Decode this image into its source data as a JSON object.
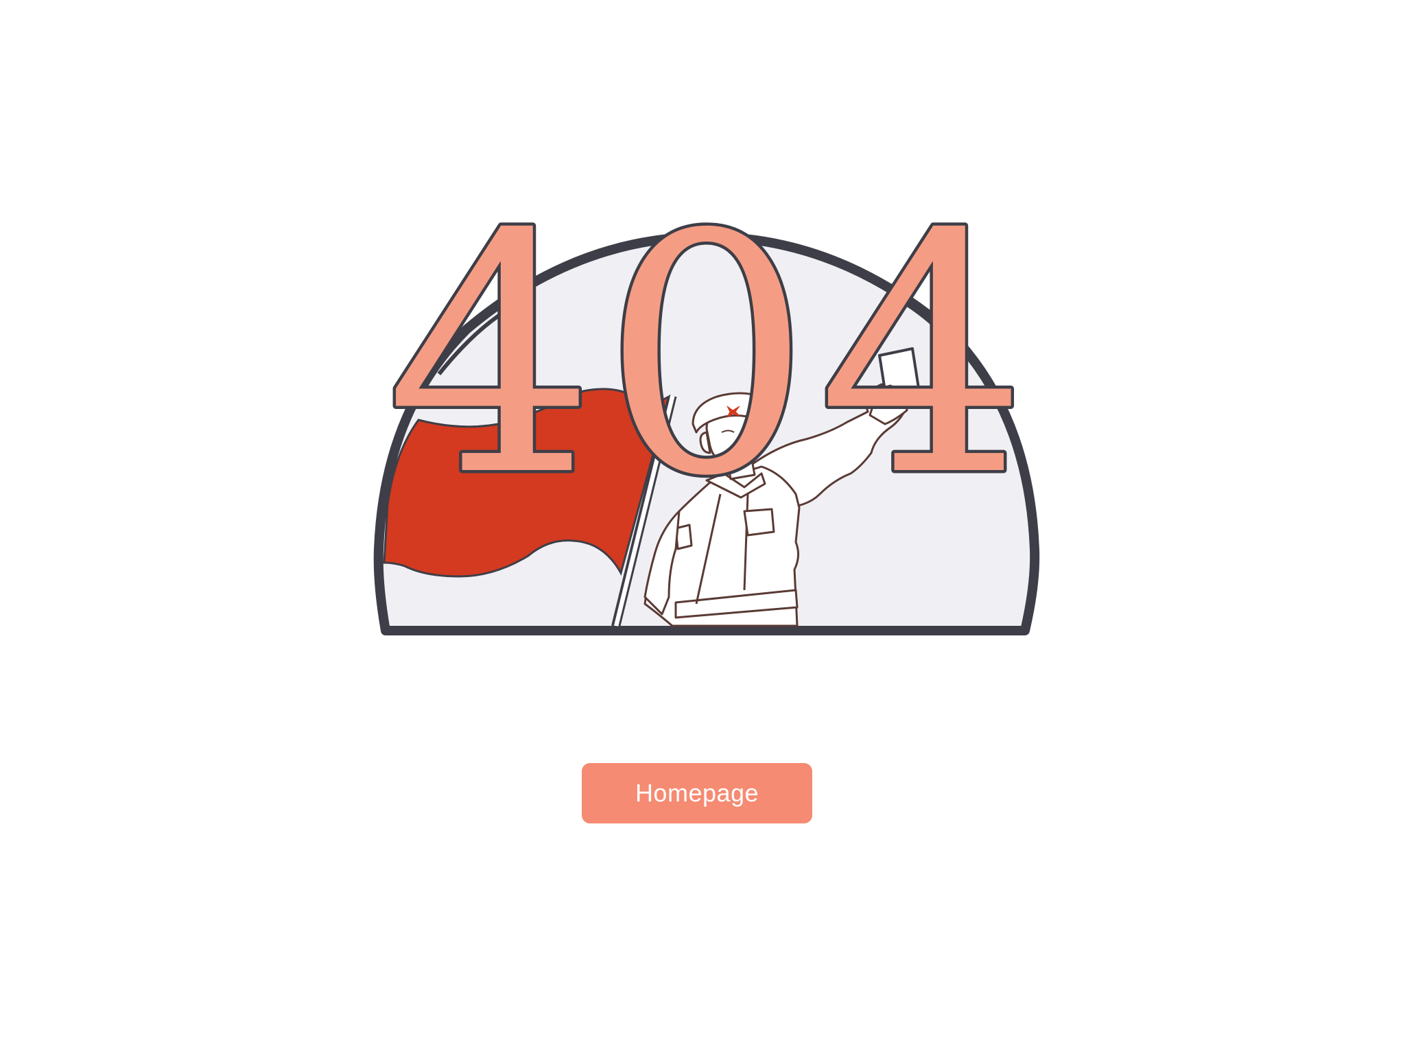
{
  "error": {
    "code_digits": [
      "4",
      "0",
      "4"
    ]
  },
  "actions": {
    "home_label": "Homepage"
  },
  "colors": {
    "digit_fill": "#f59d84",
    "outline": "#3e3e48",
    "dome_fill": "#f0f0f4",
    "flag_red": "#d33a1f",
    "button_bg": "#f58b72",
    "button_text": "#ffffff"
  },
  "icons": {
    "illustration": "soldier-with-red-flag-illustration"
  }
}
